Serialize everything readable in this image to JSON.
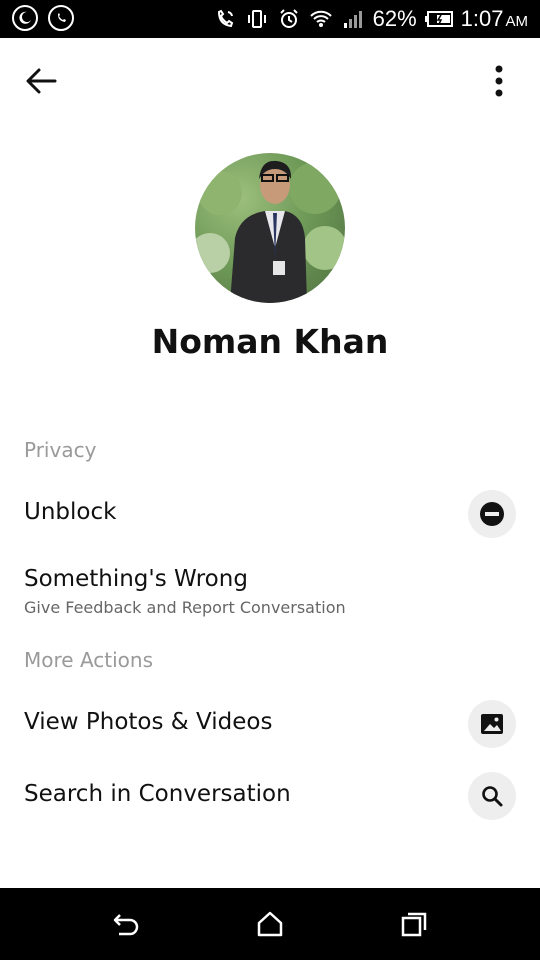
{
  "status_bar": {
    "icons_left": [
      "moon-icon",
      "whatsapp-icon"
    ],
    "icons_right": [
      "call-icon",
      "vibrate-icon",
      "alarm-icon",
      "wifi-icon",
      "signal-icon",
      "battery-icon"
    ],
    "battery": "62%",
    "time": "1:07",
    "time_suffix": "AM"
  },
  "app_bar": {
    "back_icon": "arrow-left-icon",
    "menu_icon": "more-vert-icon"
  },
  "profile": {
    "name": "Noman Khan"
  },
  "sections": {
    "privacy": {
      "header": "Privacy",
      "items": [
        {
          "title": "Unblock",
          "icon": "block-icon"
        },
        {
          "title": "Something's Wrong",
          "subtitle": "Give Feedback and Report Conversation"
        }
      ]
    },
    "more_actions": {
      "header": "More Actions",
      "items": [
        {
          "title": "View Photos & Videos",
          "icon": "image-icon"
        },
        {
          "title": "Search in Conversation",
          "icon": "search-icon"
        }
      ]
    }
  },
  "nav_bar": {
    "icons": [
      "back-icon",
      "home-icon",
      "recents-icon"
    ]
  },
  "colors": {
    "status_bar_bg": "#000000",
    "background": "#ffffff",
    "section_header": "#9a9a9a",
    "action_circle_bg": "#eeeeee"
  }
}
